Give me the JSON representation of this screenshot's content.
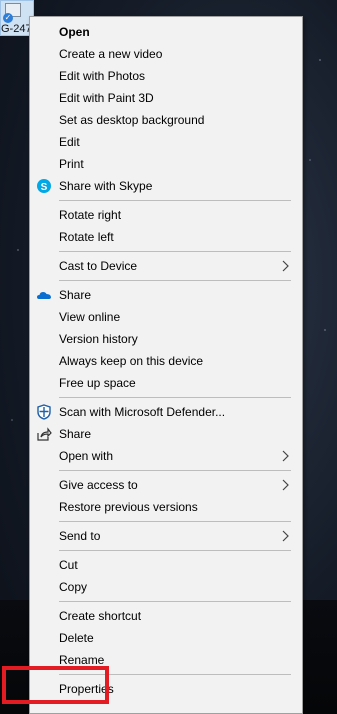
{
  "desktop_file": {
    "name": "G-247"
  },
  "menu": {
    "items": [
      {
        "label": "Open"
      },
      {
        "label": "Create a new video"
      },
      {
        "label": "Edit with Photos"
      },
      {
        "label": "Edit with Paint 3D"
      },
      {
        "label": "Set as desktop background"
      },
      {
        "label": "Edit"
      },
      {
        "label": "Print"
      },
      {
        "label": "Share with Skype"
      },
      {
        "label": "Rotate right"
      },
      {
        "label": "Rotate left"
      },
      {
        "label": "Cast to Device"
      },
      {
        "label": "Share"
      },
      {
        "label": "View online"
      },
      {
        "label": "Version history"
      },
      {
        "label": "Always keep on this device"
      },
      {
        "label": "Free up space"
      },
      {
        "label": "Scan with Microsoft Defender..."
      },
      {
        "label": "Share"
      },
      {
        "label": "Open with"
      },
      {
        "label": "Give access to"
      },
      {
        "label": "Restore previous versions"
      },
      {
        "label": "Send to"
      },
      {
        "label": "Cut"
      },
      {
        "label": "Copy"
      },
      {
        "label": "Create shortcut"
      },
      {
        "label": "Delete"
      },
      {
        "label": "Rename"
      },
      {
        "label": "Properties"
      }
    ]
  },
  "colors": {
    "highlight": "#e31b23",
    "menu_bg": "#f2f2f2"
  }
}
